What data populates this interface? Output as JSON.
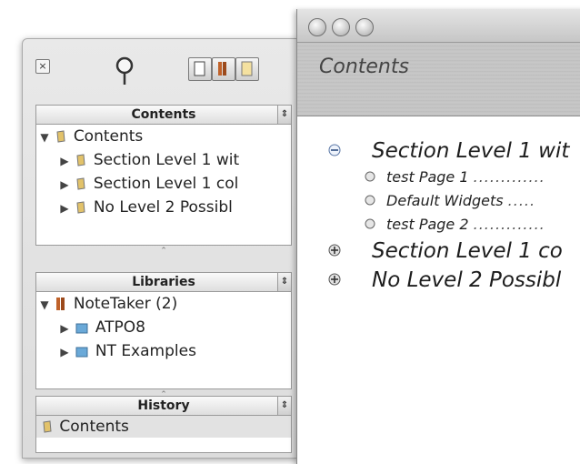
{
  "drawer": {
    "close_glyph": "×",
    "sections": {
      "contents": {
        "title": "Contents",
        "stepper": "⇕",
        "root": "Contents",
        "items": [
          "Section Level 1 wit",
          "Section Level 1 col",
          "No Level 2 Possibl"
        ]
      },
      "libraries": {
        "title": "Libraries",
        "stepper": "⇕",
        "root": "NoteTaker (2)",
        "items": [
          "ATPO8",
          "NT Examples"
        ]
      },
      "history": {
        "title": "History",
        "stepper": "⇕",
        "items": [
          "Contents"
        ]
      }
    },
    "splitter_glyph": "⌃"
  },
  "window": {
    "title": "Contents",
    "outline": [
      {
        "label": "Section Level 1 wit",
        "bullet": "expanded"
      },
      {
        "label": "test Page 1",
        "leader": ".............",
        "level": 2
      },
      {
        "label": "Default Widgets",
        "leader": ".....",
        "level": 2
      },
      {
        "label": "test Page 2",
        "leader": ".............",
        "level": 2
      },
      {
        "label": "Section Level 1 co",
        "bullet": "collapsed"
      },
      {
        "label": "No Level 2 Possibl",
        "bullet": "collapsed"
      }
    ]
  },
  "icons": [
    "close-icon",
    "magnifier-icon",
    "page-icon",
    "book-icon",
    "note-icon",
    "disclosure-triangle-icon",
    "folder-icon",
    "bullet-icon"
  ],
  "colors": {
    "accent_book": "#c0622a",
    "folder": "#6aa9d8",
    "note": "#e2c26a"
  }
}
